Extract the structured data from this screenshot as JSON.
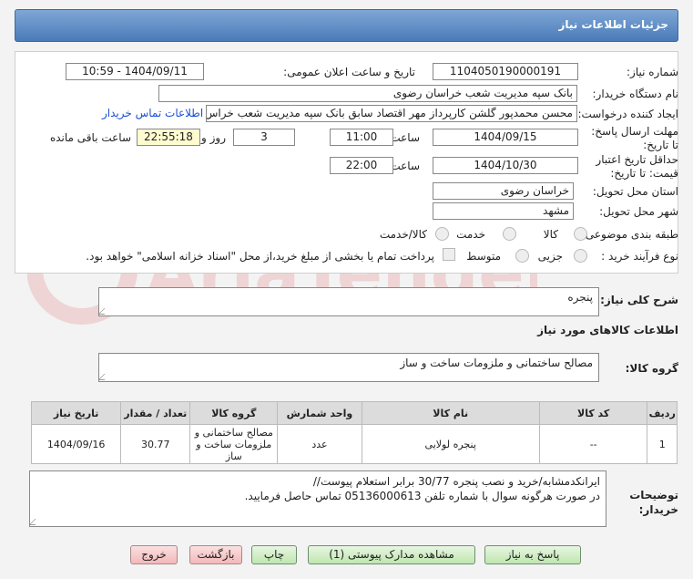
{
  "header": {
    "title": "جزئیات اطلاعات نیاز"
  },
  "form": {
    "need_number_label": "شماره نیاز:",
    "need_number": "1104050190000191",
    "announce_label": "تاریخ و ساعت اعلان عمومی:",
    "announce_value": "1404/09/11 - 10:59",
    "buyer_org_label": "نام دستگاه خریدار:",
    "buyer_org": "بانک سپه مدیریت شعب خراسان رضوی",
    "requester_label": "ایجاد کننده درخواست:",
    "requester": "محسن محمدپور گلشن کارپرداز مهر اقتصاد سابق بانک سپه مدیریت شعب خراس",
    "contact_link": "اطلاعات تماس خریدار",
    "reply_deadline_label": "مهلت ارسال پاسخ: تا تاریخ:",
    "reply_date": "1404/09/15",
    "time_label": "ساعت",
    "reply_time": "11:00",
    "days": "3",
    "days_label": "روز و",
    "remaining": "22:55:18",
    "remaining_label": "ساعت باقی مانده",
    "validity_label": "حداقل تاریخ اعتبار قیمت: تا تاریخ:",
    "validity_date": "1404/10/30",
    "validity_time_label": "ساعت",
    "validity_time": "22:00",
    "province_label": "استان محل تحویل:",
    "province": "خراسان رضوی",
    "city_label": "شهر محل تحویل:",
    "city": "مشهد",
    "category_label": "طبقه بندی موضوعی:",
    "category_options": [
      "کالا",
      "خدمت",
      "کالا/خدمت"
    ],
    "process_label": "نوع فرآیند خرید :",
    "process_options": [
      "جزیی",
      "متوسط"
    ],
    "payment_note": "پرداخت تمام یا بخشی از مبلغ خرید،از محل \"اسناد خزانه اسلامی\" خواهد بود."
  },
  "summary": {
    "label": "شرح کلی نیاز:",
    "value": "پنجره"
  },
  "goods_section": {
    "title": "اطلاعات کالاهای مورد نیاز"
  },
  "goods_group": {
    "label": "گروه کالا:",
    "value": "مصالح ساختمانی و ملزومات ساخت و ساز"
  },
  "table": {
    "headers": [
      "ردیف",
      "کد کالا",
      "نام کالا",
      "واحد شمارش",
      "گروه کالا",
      "تعداد / مقدار",
      "تاریخ نیاز"
    ],
    "rows": [
      [
        "1",
        "--",
        "پنجره لولایی",
        "عدد",
        "مصالح ساختمانی و ملزومات ساخت و ساز",
        "30.77",
        "1404/09/16"
      ]
    ]
  },
  "buyer_notes": {
    "label": "توضیحات خریدار:",
    "line1": "ایرانکدمشابه/خرید و نصب پنجره 30/77 برابر استعلام پیوست//",
    "line2": "در صورت هرگونه سوال با شماره تلفن 05136000613 تماس حاصل فرمایید."
  },
  "buttons": {
    "reply": "پاسخ به نیاز",
    "docs": "مشاهده مدارک پیوستی (1)",
    "print": "چاپ",
    "back": "بازگشت",
    "exit": "خروج"
  },
  "watermark": "AriaTender.net"
}
